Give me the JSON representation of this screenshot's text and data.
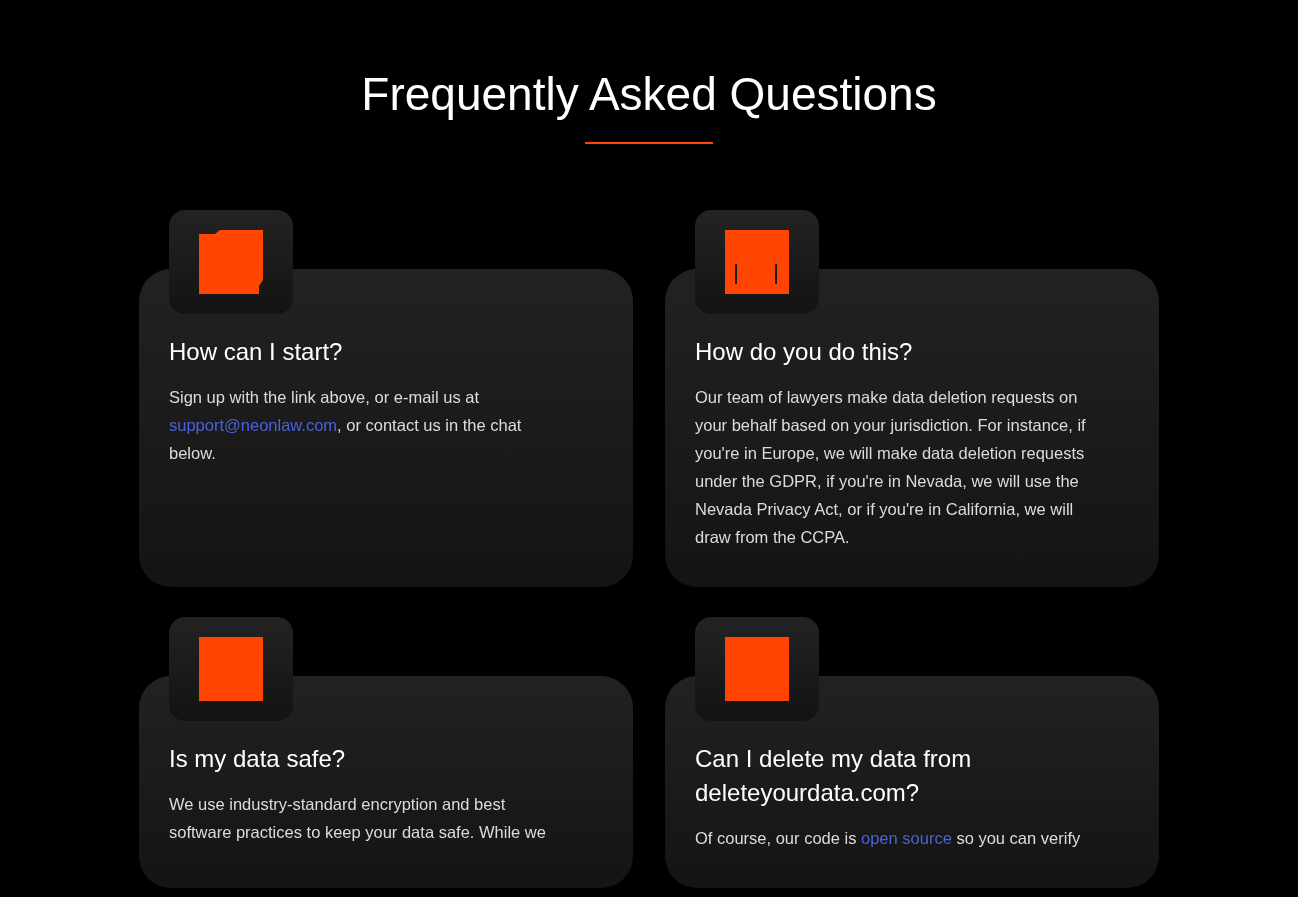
{
  "title": "Frequently Asked Questions",
  "faqs": [
    {
      "kind": "notched",
      "question": "How can I start?",
      "answer": [
        {
          "text": "Sign up with the link above, or e-mail us at "
        },
        {
          "link": "support@neonlaw.com"
        },
        {
          "text": ", or contact us in the chat below."
        }
      ]
    },
    {
      "kind": "slots",
      "question": "How do you do this?",
      "answer": [
        {
          "text": "Our team of lawyers make data deletion requests on your behalf based on your jurisdiction. For instance, if you're in Europe, we will make data deletion requests under the GDPR, if you're in Nevada, we will use the Nevada Privacy Act, or if you're in California, we will draw from the CCPA."
        }
      ]
    },
    {
      "kind": "plain",
      "question": "Is my data safe?",
      "answer": [
        {
          "text": "We use industry-standard encryption and best software practices to keep your data safe. While we"
        }
      ]
    },
    {
      "kind": "plain",
      "question": "Can I delete my data from deleteyourdata.com?",
      "answer": [
        {
          "text": "Of course, our code is "
        },
        {
          "link": "open source"
        },
        {
          "text": " so you can verify"
        }
      ]
    }
  ]
}
